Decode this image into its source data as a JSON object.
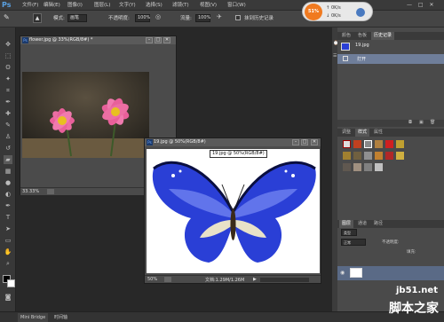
{
  "app": {
    "logo": "Ps"
  },
  "menu": [
    "文件(F)",
    "编辑(E)",
    "图像(I)",
    "图层(L)",
    "文字(Y)",
    "选择(S)",
    "滤镜(T)",
    "视图(V)",
    "窗口(W)"
  ],
  "options": {
    "mode_label": "模式:",
    "mode_value": "画笔",
    "opacity_label": "不透明度:",
    "opacity_value": "100%",
    "flow_label": "流量:",
    "flow_value": "100%",
    "erase_history": "抹到历史记录"
  },
  "perf": {
    "percent": "51%",
    "up": "0K/s",
    "down": "0K/s"
  },
  "doc_flower": {
    "title": "flower.jpg @ 33%(RGB/8#) *",
    "zoom": "33.33%"
  },
  "doc_butterfly": {
    "title": "19.jpg @ 50%(RGB/8#)",
    "tooltip": "19.jpg @ 50%(RGB/8#)",
    "zoom": "50%",
    "status": "文档:1.29M/1.26M"
  },
  "history_panel": {
    "tabs": [
      "颜色",
      "色板",
      "历史记录"
    ],
    "snapshot": "19.jpg",
    "step": "打开"
  },
  "styles_panel": {
    "tabs": [
      "调整",
      "样式",
      "属性"
    ]
  },
  "layers_panel": {
    "tabs": [
      "图层",
      "通道",
      "路径"
    ],
    "blend": "正常",
    "opacity_label": "不透明度:",
    "fill_label": "填充:"
  },
  "bottom": {
    "tabs": [
      "Mini Bridge",
      "时间轴"
    ]
  },
  "watermark": {
    "site": "jb51.net",
    "name": "脚本之家"
  },
  "colors": {
    "accent": "#f07a20",
    "blue": "#2a3fd6"
  }
}
